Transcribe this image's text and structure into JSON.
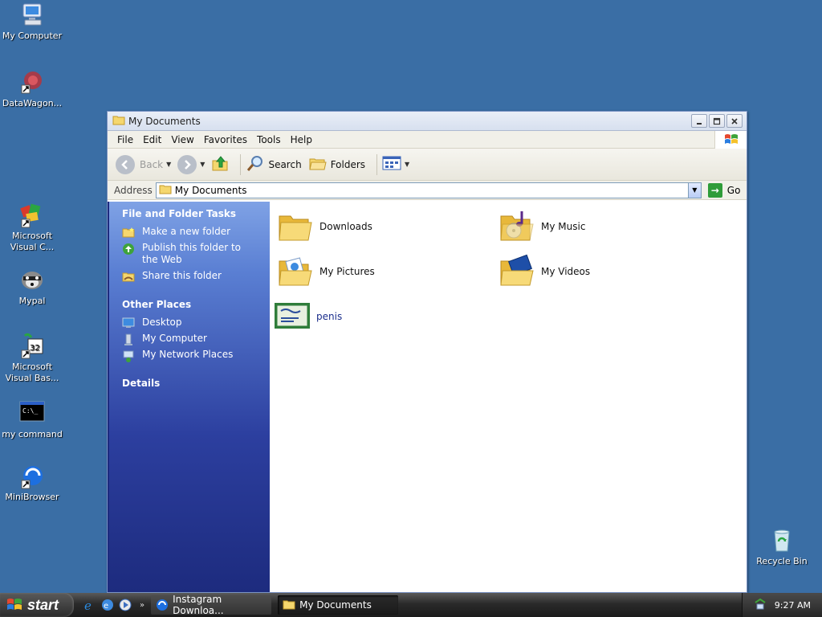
{
  "desktop": {
    "icons": [
      {
        "label": "My Computer"
      },
      {
        "label": "DataWagon..."
      },
      {
        "label": "Microsoft Visual C..."
      },
      {
        "label": "Mypal"
      },
      {
        "label": "Microsoft Visual Bas..."
      },
      {
        "label": "my command"
      },
      {
        "label": "MiniBrowser"
      },
      {
        "label": "Recycle Bin"
      }
    ]
  },
  "window": {
    "title": "My Documents",
    "menu": [
      "File",
      "Edit",
      "View",
      "Favorites",
      "Tools",
      "Help"
    ],
    "toolbar": {
      "back_label": "Back",
      "search_label": "Search",
      "folders_label": "Folders"
    },
    "address": {
      "label": "Address",
      "value": "My Documents",
      "go_label": "Go"
    },
    "taskpane": {
      "file_tasks": {
        "heading": "File and Folder Tasks",
        "items": [
          "Make a new folder",
          "Publish this folder to the Web",
          "Share this folder"
        ]
      },
      "other_places": {
        "heading": "Other Places",
        "items": [
          "Desktop",
          "My Computer",
          "My Network Places"
        ]
      },
      "details": {
        "heading": "Details"
      }
    },
    "files": [
      {
        "name": "Downloads",
        "icon": "folder-icon"
      },
      {
        "name": "My Music",
        "icon": "music-folder-icon"
      },
      {
        "name": "My Pictures",
        "icon": "pictures-folder-icon"
      },
      {
        "name": "My Videos",
        "icon": "videos-folder-icon"
      },
      {
        "name": "penis",
        "icon": "certificate-file-icon"
      }
    ]
  },
  "taskbar": {
    "start_label": "start",
    "tasks": [
      {
        "label": "Instagram Downloa..."
      },
      {
        "label": "My Documents"
      }
    ],
    "clock": "9:27 AM"
  },
  "colors": {
    "desktop": "#3a6ea5",
    "taskpane_top": "#7fa2e5",
    "taskpane_bottom": "#1d2b7e",
    "folder_yellow": "#f5d76e"
  }
}
